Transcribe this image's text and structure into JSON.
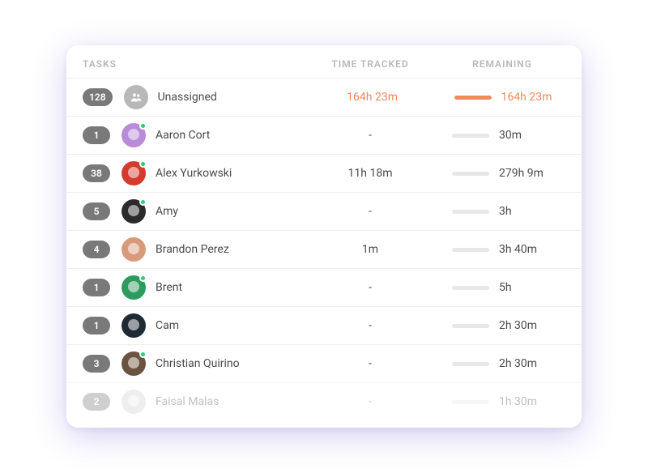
{
  "header": {
    "tasks": "TASKS",
    "tracked": "TIME TRACKED",
    "remaining": "REMAINING"
  },
  "rows": [
    {
      "count": "128",
      "name": "Unassigned",
      "tracked": "164h 23m",
      "remaining": "164h 23m",
      "tracked_highlight": true,
      "remaining_highlight": true,
      "bar_full": true,
      "avatar_type": "group",
      "avatar_bg": "#B8B8B8",
      "presence": false,
      "faded": false
    },
    {
      "count": "1",
      "name": "Aaron Cort",
      "tracked": "-",
      "remaining": "30m",
      "tracked_highlight": false,
      "remaining_highlight": false,
      "bar_full": false,
      "avatar_type": "face",
      "avatar_bg": "#B98BD9",
      "presence": true,
      "faded": false
    },
    {
      "count": "38",
      "name": "Alex Yurkowski",
      "tracked": "11h 18m",
      "remaining": "279h 9m",
      "tracked_highlight": false,
      "remaining_highlight": false,
      "bar_full": false,
      "avatar_type": "face",
      "avatar_bg": "#D43B2E",
      "presence": true,
      "faded": false
    },
    {
      "count": "5",
      "name": "Amy",
      "tracked": "-",
      "remaining": "3h",
      "tracked_highlight": false,
      "remaining_highlight": false,
      "bar_full": false,
      "avatar_type": "face",
      "avatar_bg": "#2B2B2B",
      "presence": true,
      "faded": false
    },
    {
      "count": "4",
      "name": "Brandon Perez",
      "tracked": "1m",
      "remaining": "3h 40m",
      "tracked_highlight": false,
      "remaining_highlight": false,
      "bar_full": false,
      "avatar_type": "face",
      "avatar_bg": "#D99A7B",
      "presence": false,
      "faded": false
    },
    {
      "count": "1",
      "name": "Brent",
      "tracked": "-",
      "remaining": "5h",
      "tracked_highlight": false,
      "remaining_highlight": false,
      "bar_full": false,
      "avatar_type": "face",
      "avatar_bg": "#2E9B5E",
      "presence": true,
      "faded": false
    },
    {
      "count": "1",
      "name": "Cam",
      "tracked": "-",
      "remaining": "2h 30m",
      "tracked_highlight": false,
      "remaining_highlight": false,
      "bar_full": false,
      "avatar_type": "face",
      "avatar_bg": "#1F2A36",
      "presence": false,
      "faded": false
    },
    {
      "count": "3",
      "name": "Christian Quirino",
      "tracked": "-",
      "remaining": "2h 30m",
      "tracked_highlight": false,
      "remaining_highlight": false,
      "bar_full": false,
      "avatar_type": "face",
      "avatar_bg": "#6B543F",
      "presence": true,
      "faded": false
    },
    {
      "count": "2",
      "name": "Faisal Malas",
      "tracked": "-",
      "remaining": "1h 30m",
      "tracked_highlight": false,
      "remaining_highlight": false,
      "bar_full": false,
      "avatar_type": "face",
      "avatar_bg": "#CFCFCF",
      "presence": false,
      "faded": true
    }
  ]
}
